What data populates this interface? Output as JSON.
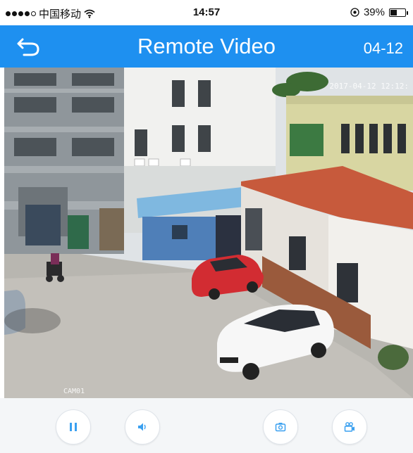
{
  "status_bar": {
    "carrier": "中国移动",
    "time": "14:57",
    "battery_percent": "39%",
    "battery_level": 0.39,
    "signal_bars_filled": 4,
    "signal_bars_total": 5,
    "wifi_icon": "wifi-icon",
    "location_icon": "location-icon"
  },
  "nav": {
    "title": "Remote Video",
    "date": "04-12",
    "back_icon": "back-arrow-icon",
    "background_color": "#1e90f0"
  },
  "video": {
    "timestamp": "2017-04-12 12:12:",
    "channel": "CAM01"
  },
  "controls": [
    {
      "name": "pause-button",
      "icon": "pause-icon"
    },
    {
      "name": "volume-button",
      "icon": "speaker-icon"
    },
    {
      "name": "snapshot-button",
      "icon": "camera-icon"
    },
    {
      "name": "record-button",
      "icon": "video-camera-icon"
    }
  ],
  "accent_color": "#3aa0f0"
}
